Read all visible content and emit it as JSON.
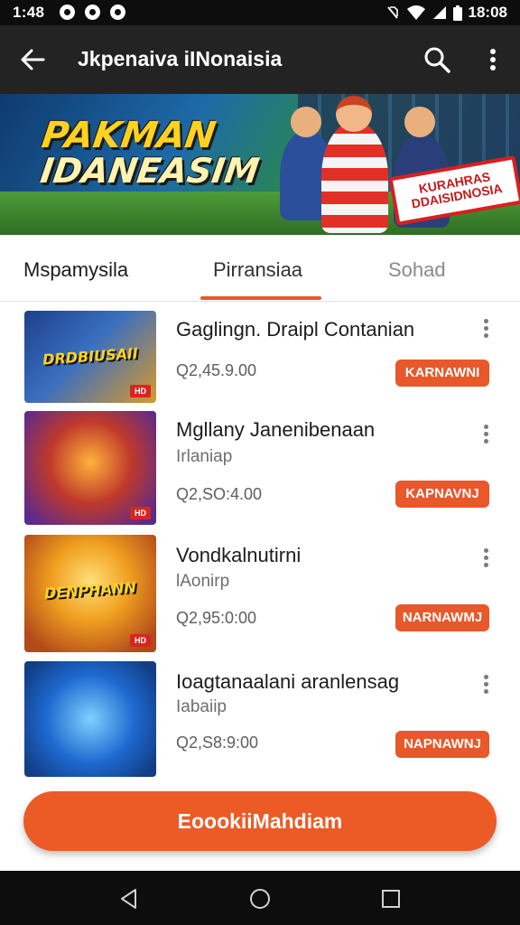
{
  "status_bar": {
    "time_left": "1:48",
    "time_right": "18:08",
    "icons": [
      "notification-icon",
      "notification-icon",
      "notification-icon",
      "no-sim-icon",
      "wifi-icon",
      "signal-icon",
      "battery-icon"
    ]
  },
  "app_bar": {
    "title": "Jkpenaiva iINonaisia",
    "back_icon": "arrow-left-icon",
    "search_icon": "search-icon",
    "more_icon": "more-vertical-icon"
  },
  "banner": {
    "title_line1": "PAKMAN",
    "title_line2": "IDANEASIM",
    "badge_line1": "KURAHRAS",
    "badge_line2": "DDAISIDNOSIA"
  },
  "tabs": [
    {
      "label": "Mspamysila",
      "selected": false
    },
    {
      "label": "Pirransiaa",
      "selected": true
    },
    {
      "label": "Sohad",
      "selected": false
    }
  ],
  "items": [
    {
      "title": "Gaglingn. Draipl Contanian",
      "subtitle": "",
      "price": "Q2,45.9.00",
      "button": "KARNAWNI",
      "thumb_text": "DRDBIUSAII",
      "thumb_tag": "HD"
    },
    {
      "title": "Mgllany Janenibenaan",
      "subtitle": "Irlaniap",
      "price": "Q2,SO:4.00",
      "button": "KAPNAVNJ",
      "thumb_text": "",
      "thumb_tag": "HD"
    },
    {
      "title": "Vondkalnutirni",
      "subtitle": "lAonirp",
      "price": "Q2,95:0:00",
      "button": "NARNAWMJ",
      "thumb_text": "DENPHANN",
      "thumb_tag": "HD"
    },
    {
      "title": "Ioagtanaalani aranlensag",
      "subtitle": "Iabaiip",
      "price": "Q2,S8:9:00",
      "button": "NAPNAWNJ",
      "thumb_text": "",
      "thumb_tag": ""
    }
  ],
  "cta": {
    "label": "EoookiiMahdiam"
  },
  "nav_bar": {
    "icons": [
      "back-triangle-icon",
      "home-circle-icon",
      "recents-square-icon"
    ]
  },
  "colors": {
    "accent": "#e8582a",
    "app_bar": "#232323",
    "status_bar": "#0d0d0d"
  }
}
